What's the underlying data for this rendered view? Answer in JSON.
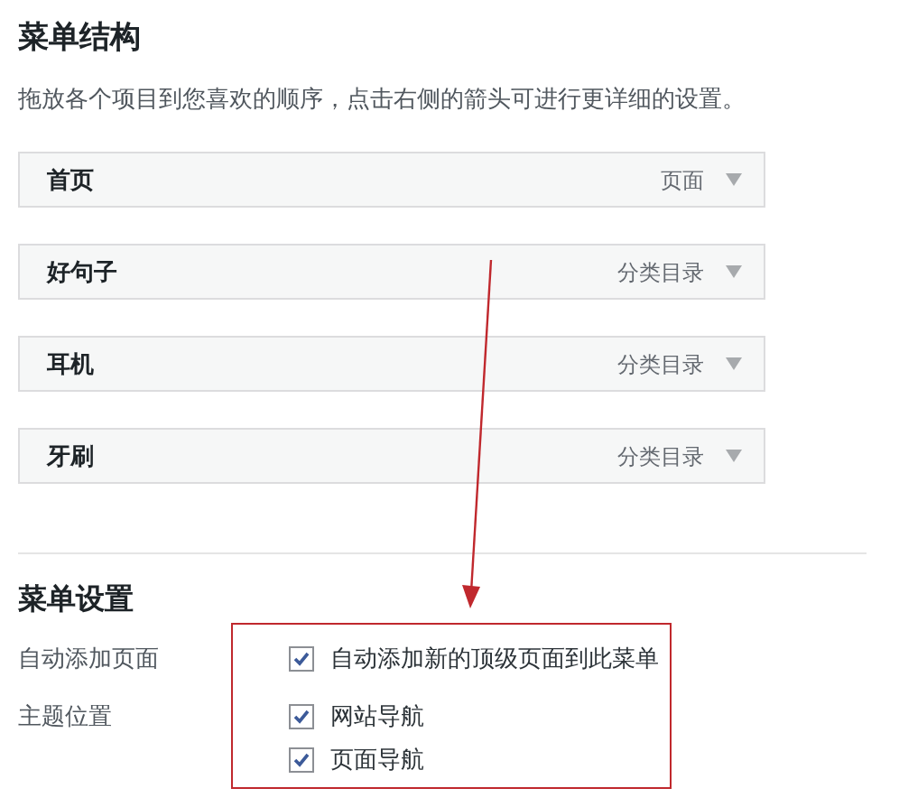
{
  "structure": {
    "title": "菜单结构",
    "description": "拖放各个项目到您喜欢的顺序，点击右侧的箭头可进行更详细的设置。",
    "items": [
      {
        "label": "首页",
        "type": "页面"
      },
      {
        "label": "好句子",
        "type": "分类目录"
      },
      {
        "label": "耳机",
        "type": "分类目录"
      },
      {
        "label": "牙刷",
        "type": "分类目录"
      }
    ]
  },
  "settings": {
    "title": "菜单设置",
    "rows": [
      {
        "label": "自动添加页面",
        "options": [
          {
            "label": "自动添加新的顶级页面到此菜单",
            "checked": true
          }
        ]
      },
      {
        "label": "主题位置",
        "options": [
          {
            "label": "网站导航",
            "checked": true
          },
          {
            "label": "页面导航",
            "checked": true
          }
        ]
      }
    ]
  }
}
